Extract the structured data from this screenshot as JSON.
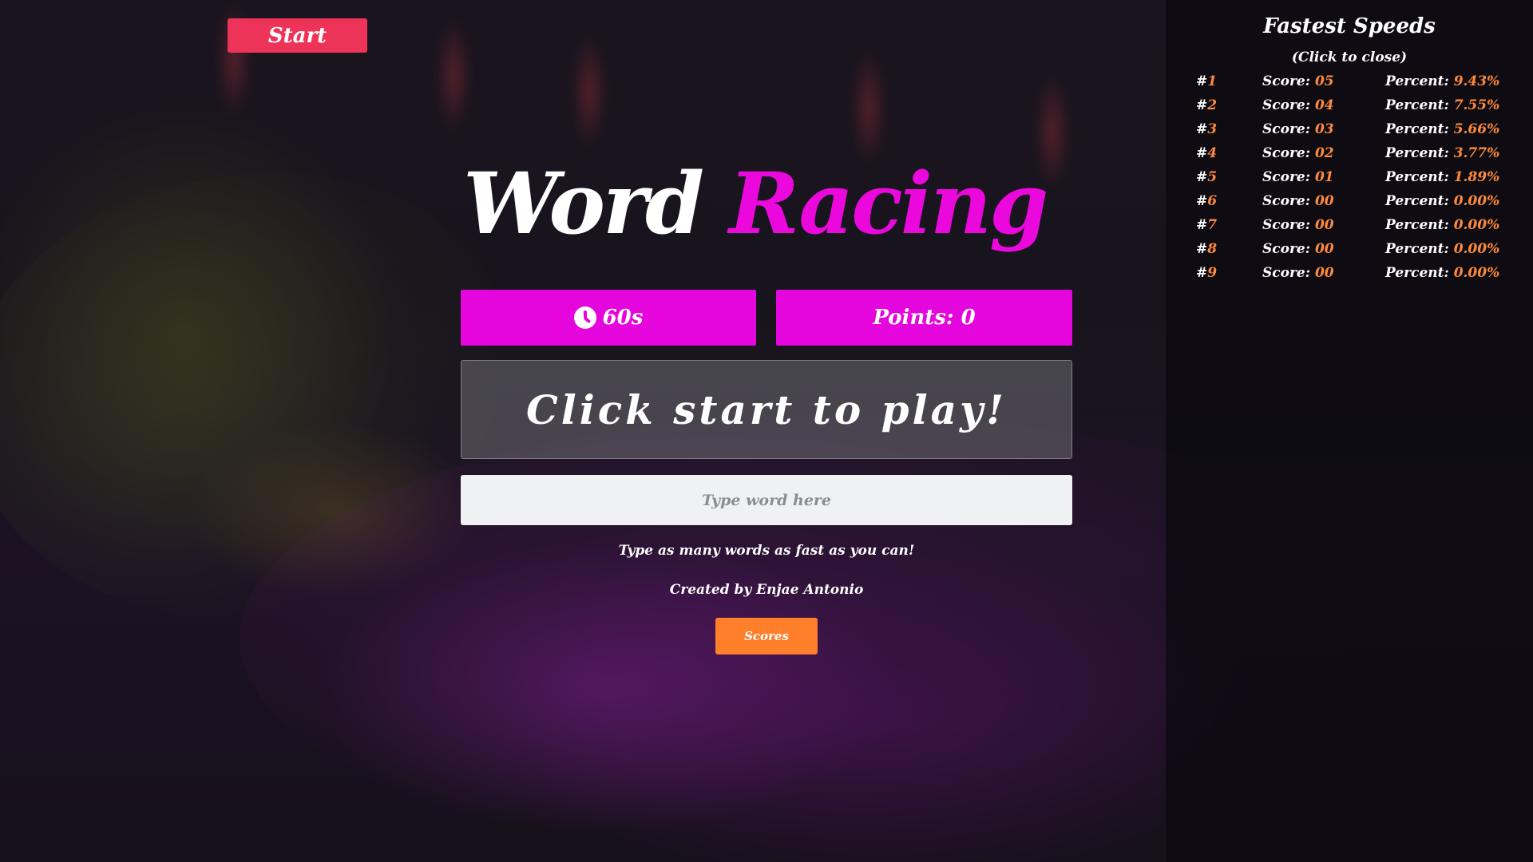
{
  "start_button": {
    "label": "Start"
  },
  "title": {
    "word1": "Word",
    "word2": "Racing"
  },
  "timer": {
    "icon": "clock-icon",
    "value": "60s"
  },
  "points": {
    "label": "Points: 0"
  },
  "word_display": {
    "text": "Click start to play!"
  },
  "word_input": {
    "placeholder": "Type word here",
    "value": ""
  },
  "tagline": "Type as many words as fast as you can!",
  "credit": "Created by Enjae Antonio",
  "scores_button": {
    "label": "Scores"
  },
  "leaderboard": {
    "title": "Fastest Speeds",
    "subtitle": "(Click to close)",
    "score_label": "Score:",
    "percent_label": "Percent:",
    "rows": [
      {
        "rank": "1",
        "score": "05",
        "percent": "9.43%"
      },
      {
        "rank": "2",
        "score": "04",
        "percent": "7.55%"
      },
      {
        "rank": "3",
        "score": "03",
        "percent": "5.66%"
      },
      {
        "rank": "4",
        "score": "02",
        "percent": "3.77%"
      },
      {
        "rank": "5",
        "score": "01",
        "percent": "1.89%"
      },
      {
        "rank": "6",
        "score": "00",
        "percent": "0.00%"
      },
      {
        "rank": "7",
        "score": "00",
        "percent": "0.00%"
      },
      {
        "rank": "8",
        "score": "00",
        "percent": "0.00%"
      },
      {
        "rank": "9",
        "score": "00",
        "percent": "0.00%"
      }
    ]
  },
  "colors": {
    "accent_magenta": "#e406dc",
    "start_red": "#ee3358",
    "scores_orange": "#ff7f2a",
    "leaderboard_value_orange": "#ff8a3d"
  }
}
